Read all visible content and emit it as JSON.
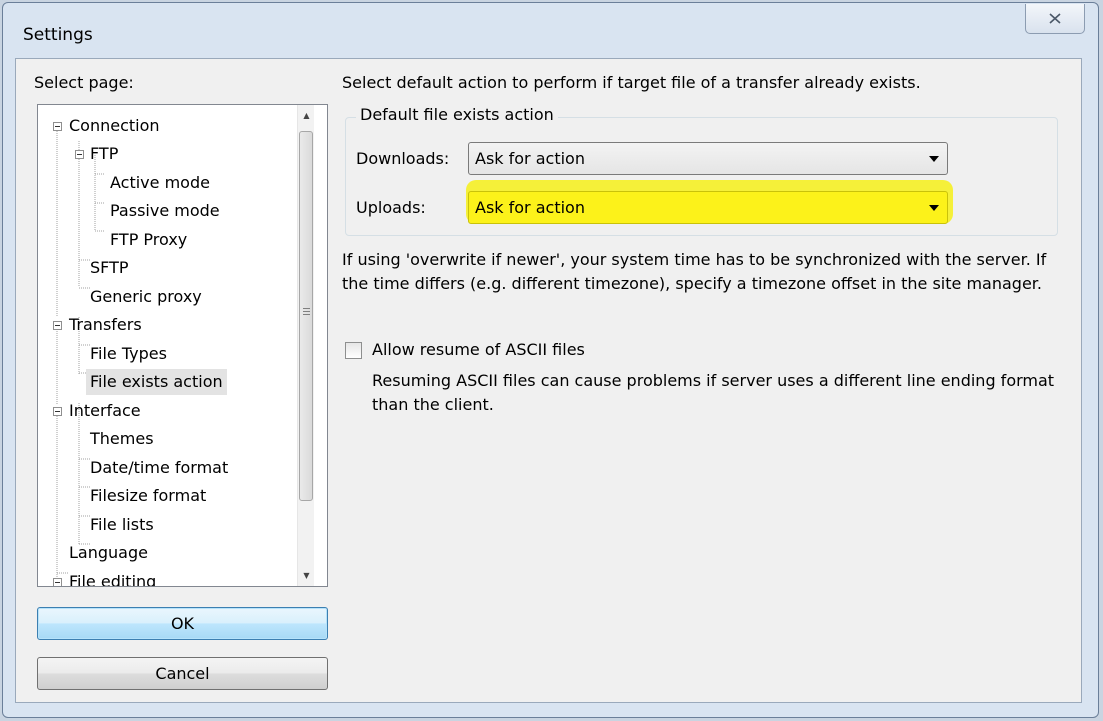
{
  "window": {
    "title": "Settings"
  },
  "left_panel": {
    "label": "Select page:",
    "tree": [
      {
        "label": "Connection"
      },
      {
        "label": "FTP"
      },
      {
        "label": "Active mode"
      },
      {
        "label": "Passive mode"
      },
      {
        "label": "FTP Proxy"
      },
      {
        "label": "SFTP"
      },
      {
        "label": "Generic proxy"
      },
      {
        "label": "Transfers"
      },
      {
        "label": "File Types"
      },
      {
        "label": "File exists action"
      },
      {
        "label": "Interface"
      },
      {
        "label": "Themes"
      },
      {
        "label": "Date/time format"
      },
      {
        "label": "Filesize format"
      },
      {
        "label": "File lists"
      },
      {
        "label": "Language"
      },
      {
        "label": "File editing"
      }
    ],
    "selected": "File exists action"
  },
  "buttons": {
    "ok": "OK",
    "cancel": "Cancel"
  },
  "main": {
    "intro": "Select default action to perform if target file of a transfer already exists.",
    "group_title": "Default file exists action",
    "downloads": {
      "label": "Downloads:",
      "value": "Ask for action"
    },
    "uploads": {
      "label": "Uploads:",
      "value": "Ask for action"
    },
    "note": "If using 'overwrite if newer', your system time has to be synchronized with the server. If the time differs (e.g. different timezone), specify a timezone offset in the site manager.",
    "resume_checkbox": {
      "label": "Allow resume of ASCII files",
      "checked": false
    },
    "resume_desc": "Resuming ASCII files can cause problems if server uses a different line ending format than the client."
  },
  "colors": {
    "highlight": "#fcf21a",
    "default_button": "#bee6fd"
  }
}
